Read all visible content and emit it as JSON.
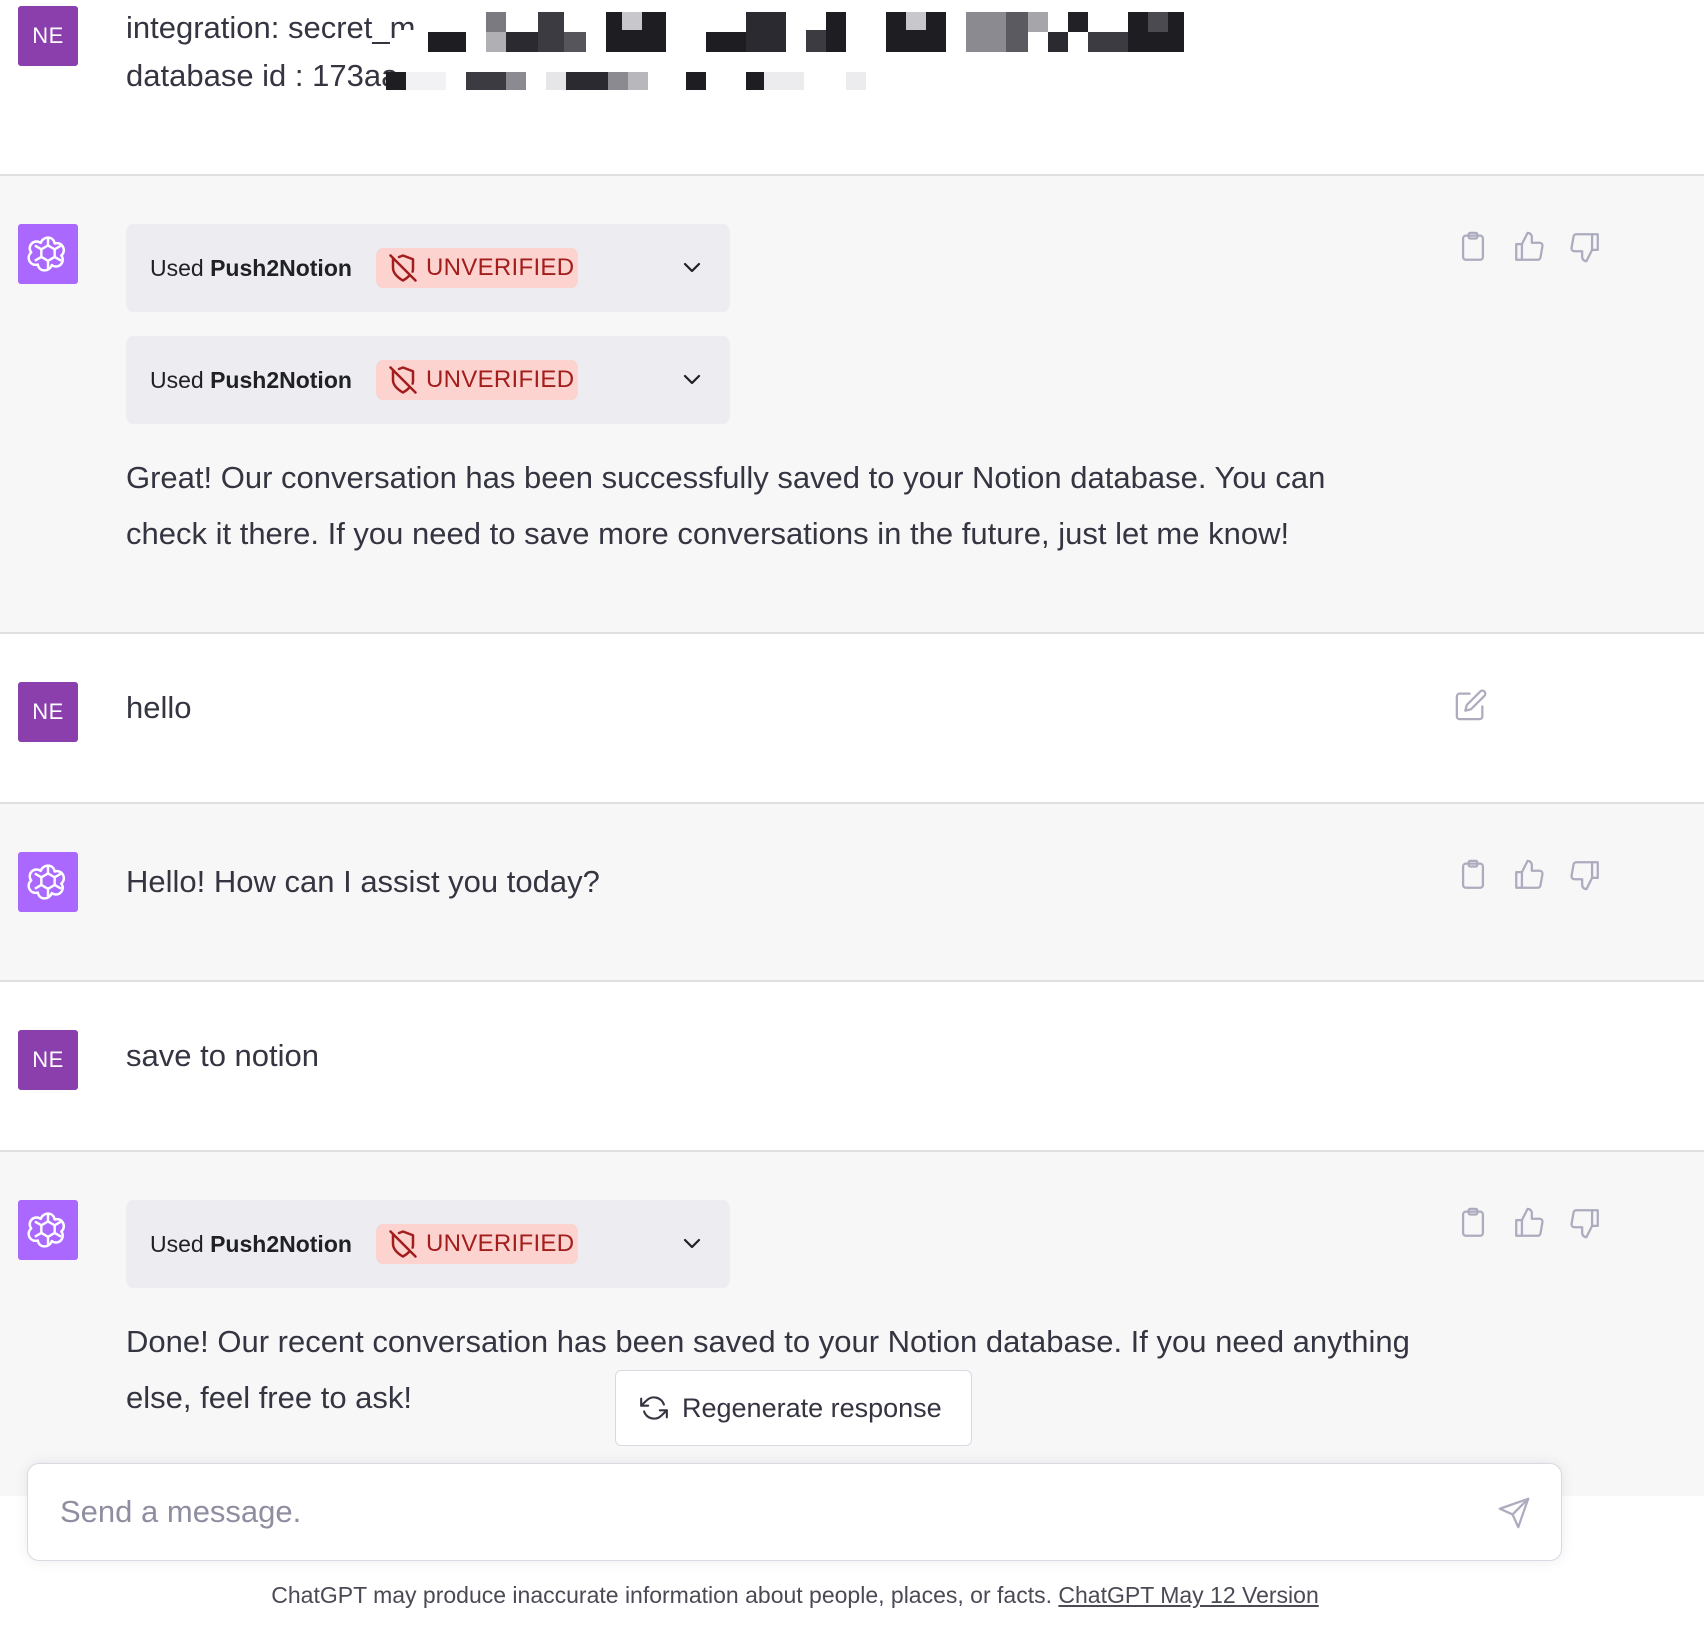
{
  "messages": {
    "m1": {
      "role": "user",
      "avatar_initials": "NE",
      "line1": "integration: secret_m",
      "line2": "database id : 173aa"
    },
    "m2": {
      "role": "assistant",
      "plugins": [
        {
          "used_label": "Used",
          "plugin_name": "Push2Notion",
          "badge": "UNVERIFIED"
        },
        {
          "used_label": "Used",
          "plugin_name": "Push2Notion",
          "badge": "UNVERIFIED"
        }
      ],
      "line1": "Great! Our conversation has been successfully saved to your Notion database. You can",
      "line2": "check it there. If you need to save more conversations in the future, just let me know!"
    },
    "m3": {
      "role": "user",
      "avatar_initials": "NE",
      "text": "hello"
    },
    "m4": {
      "role": "assistant",
      "text": "Hello! How can I assist you today?"
    },
    "m5": {
      "role": "user",
      "avatar_initials": "NE",
      "text": "save to notion"
    },
    "m6": {
      "role": "assistant",
      "plugins": [
        {
          "used_label": "Used",
          "plugin_name": "Push2Notion",
          "badge": "UNVERIFIED"
        }
      ],
      "line1": "Done! Our recent conversation has been saved to your Notion database. If you need anything",
      "line2": "else, feel free to ask!"
    }
  },
  "regenerate": {
    "label": "Regenerate response"
  },
  "composer": {
    "placeholder": "Send a message."
  },
  "footer": {
    "disclaimer": "ChatGPT may produce inaccurate information about people, places, or facts.",
    "version_link": "ChatGPT May 12 Version"
  },
  "icons": {
    "assistant_avatar": "openai-logo-icon",
    "badge": "shield-off-icon",
    "expand": "chevron-down-icon",
    "copy": "clipboard-icon",
    "like": "thumbs-up-icon",
    "dislike": "thumbs-down-icon",
    "edit": "edit-icon",
    "regenerate": "refresh-icon",
    "send": "paper-plane-icon"
  },
  "colors": {
    "user_avatar": "#8b3fad",
    "assistant_avatar": "#ab68ff",
    "assistant_bg": "#f7f7f8",
    "badge_bg": "#fdd3d0",
    "badge_text": "#a31d1d",
    "plugin_bg": "#ececf1"
  }
}
